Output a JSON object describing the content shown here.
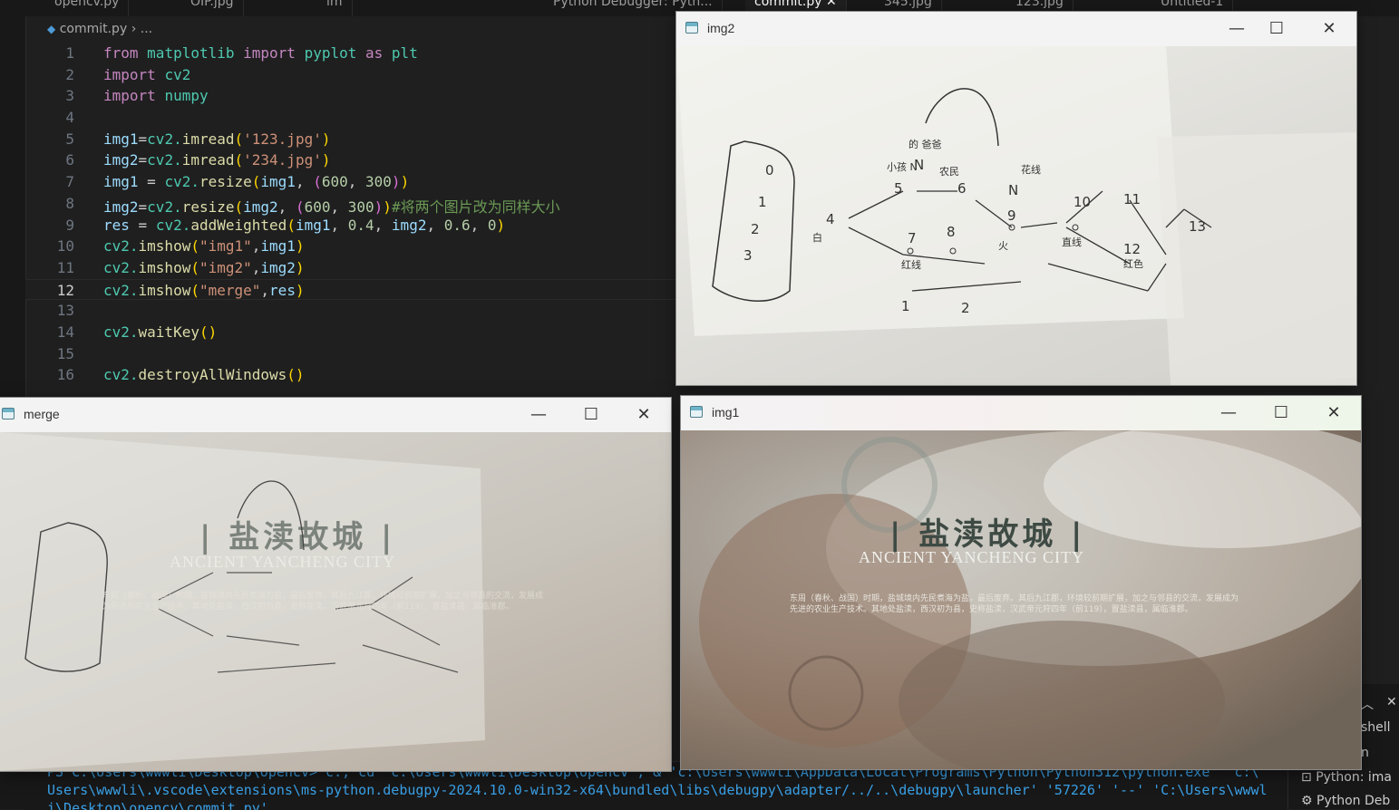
{
  "tabs": [
    {
      "label": "opencv.py"
    },
    {
      "label": "OIP.jpg"
    },
    {
      "label": "im"
    },
    {
      "label": "Python Debugger: Pyth..."
    },
    {
      "label": "commit.py",
      "active": true,
      "close": "✕"
    },
    {
      "label": "345.jpg"
    },
    {
      "label": "123.jpg"
    },
    {
      "label": "Untitled-1"
    }
  ],
  "breadcrumb": {
    "file": "commit.py",
    "sep": "›",
    "rest": "..."
  },
  "code_lines": [
    "1",
    "2",
    "3",
    "4",
    "5",
    "6",
    "7",
    "8",
    "9",
    "10",
    "11",
    "12",
    "13",
    "14",
    "15",
    "16"
  ],
  "code": {
    "l1": {
      "from": "from",
      "mod": "matplotlib",
      "imp": "import",
      "name": "pyplot",
      "as": "as",
      "alias": "plt"
    },
    "l2": {
      "imp": "import",
      "mod": "cv2"
    },
    "l3": {
      "imp": "import",
      "mod": "numpy"
    },
    "l5": {
      "var": "img1",
      "eq": "=",
      "obj": "cv2.",
      "fn": "imread",
      "arg": "'123.jpg'"
    },
    "l6": {
      "var": "img2",
      "eq": "=",
      "obj": "cv2.",
      "fn": "imread",
      "arg": "'234.jpg'"
    },
    "l7": {
      "var": "img1",
      "eq": " = ",
      "obj": "cv2.",
      "fn": "resize",
      "a1": "img1",
      "n1": "600",
      "n2": "300"
    },
    "l8": {
      "var": "img2",
      "eq": "=",
      "obj": "cv2.",
      "fn": "resize",
      "a1": "img2",
      "n1": "600",
      "n2": "300",
      "comment": "#将两个图片改为同样大小"
    },
    "l9": {
      "var": "res",
      "eq": " = ",
      "obj": "cv2.",
      "fn": "addWeighted",
      "a1": "img1",
      "n1": "0.4",
      "a2": "img2",
      "n2": "0.6",
      "n3": "0"
    },
    "l10": {
      "obj": "cv2.",
      "fn": "imshow",
      "s": "\"img1\"",
      "a": "img1"
    },
    "l11": {
      "obj": "cv2.",
      "fn": "imshow",
      "s": "\"img2\"",
      "a": "img2"
    },
    "l12": {
      "obj": "cv2.",
      "fn": "imshow",
      "s": "\"merge\"",
      "a": "res"
    },
    "l14": {
      "obj": "cv2.",
      "fn": "waitKey"
    },
    "l16": {
      "obj": "cv2.",
      "fn": "destroyAllWindows"
    }
  },
  "terminal": {
    "line1": "PS C:\\Users\\wwwli\\Desktop\\opencv>  c:; cd 'c:\\Users\\wwwli\\Desktop\\opencv'; & 'c:\\Users\\wwwli\\AppData\\Local\\Programs\\Python\\Python312\\python.exe' 'c:\\",
    "line2": "Users\\wwwli\\.vscode\\extensions\\ms-python.debugpy-2024.10.0-win32-x64\\bundled\\libs\\debugpy\\adapter/../..\\debugpy\\launcher' '57226' '--' 'C:\\Users\\wwwl",
    "line3": "i\\Desktop\\opencv\\commit.py'"
  },
  "terminal_panel": {
    "items": [
      "shell",
      "n",
      "Python: ima",
      "Python Deb"
    ]
  },
  "windows": {
    "img2": {
      "title": "img2"
    },
    "merge": {
      "title": "merge"
    },
    "img1": {
      "title": "img1"
    },
    "controls": {
      "minimize": "—",
      "maximize": "☐",
      "close": "✕"
    }
  },
  "image_text": {
    "heading": "| 盐渎故城 |",
    "subhead": "ANCIENT YANCHENG CITY",
    "para": "东周（春秋、战国）时期，盐城境内先民煮海为盐，最后废弃。其后九江郡，环境较前期扩展，加之与邻县的交流，发展成为先进的农业生产技术。其地处盐渎，西汉初为县，史称盐渎，汉武帝元狩四年（前119），置盐渎县，属临淮郡。",
    "notes": [
      "0",
      "1",
      "2",
      "3",
      "5",
      "6",
      "7",
      "8",
      "9",
      "10",
      "11",
      "12",
      "13",
      "4",
      "N",
      "N",
      "1",
      "2",
      "的 爸爸",
      "小孩 N",
      "农民",
      "红线",
      "白",
      "花线",
      "直线",
      "火",
      "红色"
    ]
  }
}
